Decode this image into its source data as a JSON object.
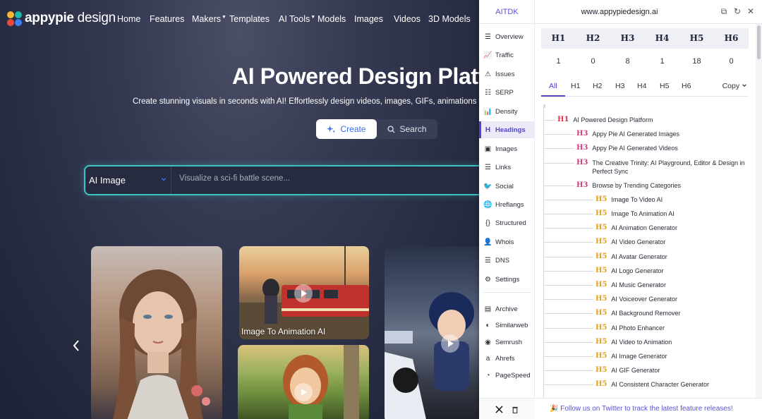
{
  "site": {
    "logo_bold": "appypie",
    "logo_thin": " design",
    "nav": [
      {
        "label": "Home",
        "caret": false
      },
      {
        "label": "Features",
        "caret": false
      },
      {
        "label": "Makers",
        "caret": true
      },
      {
        "label": "Templates",
        "caret": false
      },
      {
        "label": "AI Tools",
        "caret": true
      },
      {
        "label": "Models",
        "caret": false
      },
      {
        "label": "Images",
        "caret": false
      },
      {
        "label": "Videos",
        "caret": false
      },
      {
        "label": "3D Models",
        "caret": false
      }
    ],
    "hero_title": "AI Powered Design Platf",
    "hero_subtitle": "Create stunning visuals in seconds with AI! Effortlessly design videos, images, GIFs, animations",
    "create_label": "Create",
    "search_label": "Search",
    "prompt_select": "AI Image",
    "prompt_placeholder": "Visualize a sci-fi battle scene...",
    "card_caption": "Image To Animation AI"
  },
  "ext": {
    "brand": "AITDK",
    "domain": "www.appypiedesign.ai",
    "sidebar": [
      {
        "label": "Overview",
        "icon": "overview-icon",
        "glyph": "☰"
      },
      {
        "label": "Traffic",
        "icon": "traffic-icon",
        "glyph": "📈"
      },
      {
        "label": "Issues",
        "icon": "issues-icon",
        "glyph": "⚠"
      },
      {
        "label": "SERP",
        "icon": "serp-icon",
        "glyph": "☷"
      },
      {
        "label": "Density",
        "icon": "density-icon",
        "glyph": "📊"
      },
      {
        "label": "Headings",
        "icon": "headings-icon",
        "glyph": "H"
      },
      {
        "label": "Images",
        "icon": "images-icon",
        "glyph": "▣"
      },
      {
        "label": "Links",
        "icon": "links-icon",
        "glyph": "☰"
      },
      {
        "label": "Social",
        "icon": "social-icon",
        "glyph": "🐦"
      },
      {
        "label": "Hreflangs",
        "icon": "hreflangs-icon",
        "glyph": "🌐"
      },
      {
        "label": "Structured",
        "icon": "structured-icon",
        "glyph": "{}"
      },
      {
        "label": "Whois",
        "icon": "whois-icon",
        "glyph": "👤"
      },
      {
        "label": "DNS",
        "icon": "dns-icon",
        "glyph": "☰"
      },
      {
        "label": "Settings",
        "icon": "settings-icon",
        "glyph": "⚙"
      }
    ],
    "tools": [
      {
        "label": "Archive",
        "icon": "archive-icon",
        "glyph": "▤"
      },
      {
        "label": "Similarweb",
        "icon": "similarweb-icon",
        "glyph": "◐"
      },
      {
        "label": "Semrush",
        "icon": "semrush-icon",
        "glyph": "◉"
      },
      {
        "label": "Ahrefs",
        "icon": "ahrefs-icon",
        "glyph": "a"
      },
      {
        "label": "PageSpeed",
        "icon": "pagespeed-icon",
        "glyph": "◔"
      }
    ],
    "heading_counts": [
      {
        "label": "H1",
        "count": "1"
      },
      {
        "label": "H2",
        "count": "0"
      },
      {
        "label": "H3",
        "count": "8"
      },
      {
        "label": "H4",
        "count": "1"
      },
      {
        "label": "H5",
        "count": "18"
      },
      {
        "label": "H6",
        "count": "0"
      }
    ],
    "tabs": [
      "All",
      "H1",
      "H2",
      "H3",
      "H4",
      "H5",
      "H6"
    ],
    "copy_label": "Copy",
    "headings": [
      {
        "tag": "H1",
        "text": "AI Powered Design Platform"
      },
      {
        "tag": "H3",
        "text": "Appy Pie AI Generated Images"
      },
      {
        "tag": "H3",
        "text": "Appy Pie AI Generated Videos"
      },
      {
        "tag": "H3",
        "text": "The Creative Trinity: AI Playground, Editor & Design in Perfect Sync"
      },
      {
        "tag": "H3",
        "text": "Browse by Trending Categories"
      },
      {
        "tag": "H5",
        "text": "Image To Video AI"
      },
      {
        "tag": "H5",
        "text": "Image To Animation AI"
      },
      {
        "tag": "H5",
        "text": "AI Animation Generator"
      },
      {
        "tag": "H5",
        "text": "AI Video Generator"
      },
      {
        "tag": "H5",
        "text": "AI Avatar Generator"
      },
      {
        "tag": "H5",
        "text": "AI Logo Generator"
      },
      {
        "tag": "H5",
        "text": "AI Music Generator"
      },
      {
        "tag": "H5",
        "text": "AI Voiceover Generator"
      },
      {
        "tag": "H5",
        "text": "AI Background Remover"
      },
      {
        "tag": "H5",
        "text": "AI Photo Enhancer"
      },
      {
        "tag": "H5",
        "text": "AI Video to Animation"
      },
      {
        "tag": "H5",
        "text": "AI Image Generator"
      },
      {
        "tag": "H5",
        "text": "AI GIF Generator"
      },
      {
        "tag": "H5",
        "text": "AI Consistent Character Generator"
      }
    ],
    "footer_message": "🎉 Follow us on Twitter to track the latest feature releases!"
  },
  "colors": {
    "accent": "#4f46c8",
    "h1": "#e0314d",
    "h3": "#d23a7c",
    "h5": "#e0a020",
    "prompt_border": "#3ec3c4"
  }
}
